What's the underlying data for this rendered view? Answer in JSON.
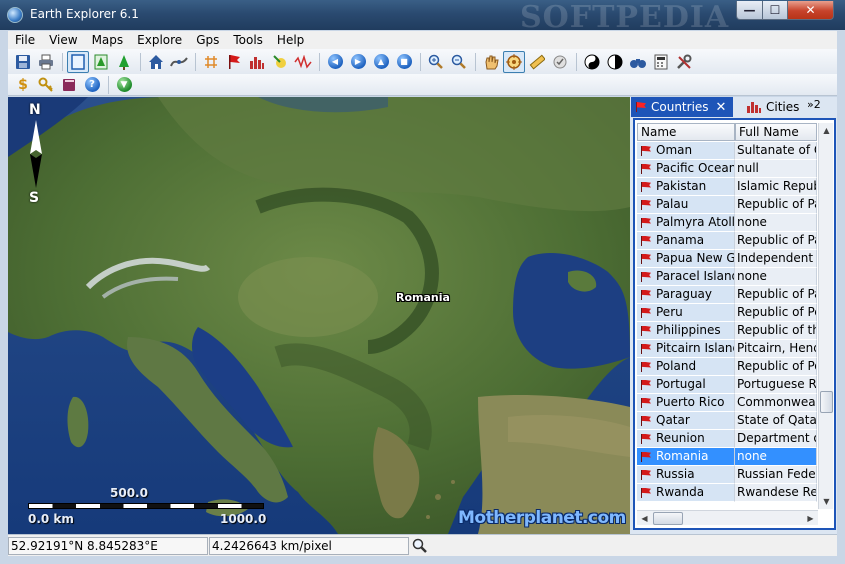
{
  "window": {
    "title": "Earth Explorer 6.1",
    "watermark": "SOFTPEDIA",
    "minimize": "—",
    "maximize": "☐",
    "close": "✕"
  },
  "menu": [
    "File",
    "View",
    "Maps",
    "Explore",
    "Gps",
    "Tools",
    "Help"
  ],
  "map": {
    "compass_n": "N",
    "compass_s": "S",
    "place_label": "Romania",
    "scale_mid": "500.0",
    "scale_start": "0.0 km",
    "scale_end": "1000.0",
    "brand": "Motherplanet.com"
  },
  "panel": {
    "tabs": [
      {
        "label": "Countries",
        "active": true,
        "close": "✕"
      },
      {
        "label": "Cities",
        "active": false
      }
    ],
    "more": "»2",
    "columns": [
      "Name",
      "Full Name"
    ],
    "rows": [
      {
        "name": "Oman",
        "full": "Sultanate of Oman"
      },
      {
        "name": "Pacific Ocean",
        "full": "null"
      },
      {
        "name": "Pakistan",
        "full": "Islamic Republic"
      },
      {
        "name": "Palau",
        "full": "Republic of Palau"
      },
      {
        "name": "Palmyra Atoll",
        "full": "none"
      },
      {
        "name": "Panama",
        "full": "Republic of Panama"
      },
      {
        "name": "Papua New G...",
        "full": "Independent State"
      },
      {
        "name": "Paracel Islands",
        "full": "none"
      },
      {
        "name": "Paraguay",
        "full": "Republic of Paraguay"
      },
      {
        "name": "Peru",
        "full": "Republic of Peru"
      },
      {
        "name": "Philippines",
        "full": "Republic of the"
      },
      {
        "name": "Pitcairn Islands",
        "full": "Pitcairn, Henderson"
      },
      {
        "name": "Poland",
        "full": "Republic of Poland"
      },
      {
        "name": "Portugal",
        "full": "Portuguese Republic"
      },
      {
        "name": "Puerto Rico",
        "full": "Commonwealth"
      },
      {
        "name": "Qatar",
        "full": "State of Qatar"
      },
      {
        "name": "Reunion",
        "full": "Department of"
      },
      {
        "name": "Romania",
        "full": "none",
        "selected": true
      },
      {
        "name": "Russia",
        "full": "Russian Federation"
      },
      {
        "name": "Rwanda",
        "full": "Rwandese Republic"
      }
    ],
    "selected_color": "#3390ff"
  },
  "status": {
    "coords": "52.92191°N 8.845283°E",
    "scale": "4.2426643 km/pixel"
  },
  "icons": {
    "toolbar1": [
      "save-icon",
      "print-icon",
      "map-frame-icon",
      "tree-icon",
      "pine-icon",
      "home-icon",
      "route-icon",
      "grid-icon",
      "flag-icon",
      "city-icon",
      "cursor-plus-icon",
      "river-icon",
      "back-icon",
      "forward-icon",
      "up-icon",
      "stop-icon",
      "zoom-in-icon",
      "zoom-out-icon",
      "hand-icon",
      "target-icon",
      "ruler-icon",
      "gps-icon",
      "yin-yang-icon",
      "contrast-icon",
      "binoculars-icon",
      "calculator-icon",
      "tools-icon"
    ],
    "toolbar2": [
      "dollar-icon",
      "key-icon",
      "book-icon",
      "help-icon",
      "download-icon"
    ]
  }
}
